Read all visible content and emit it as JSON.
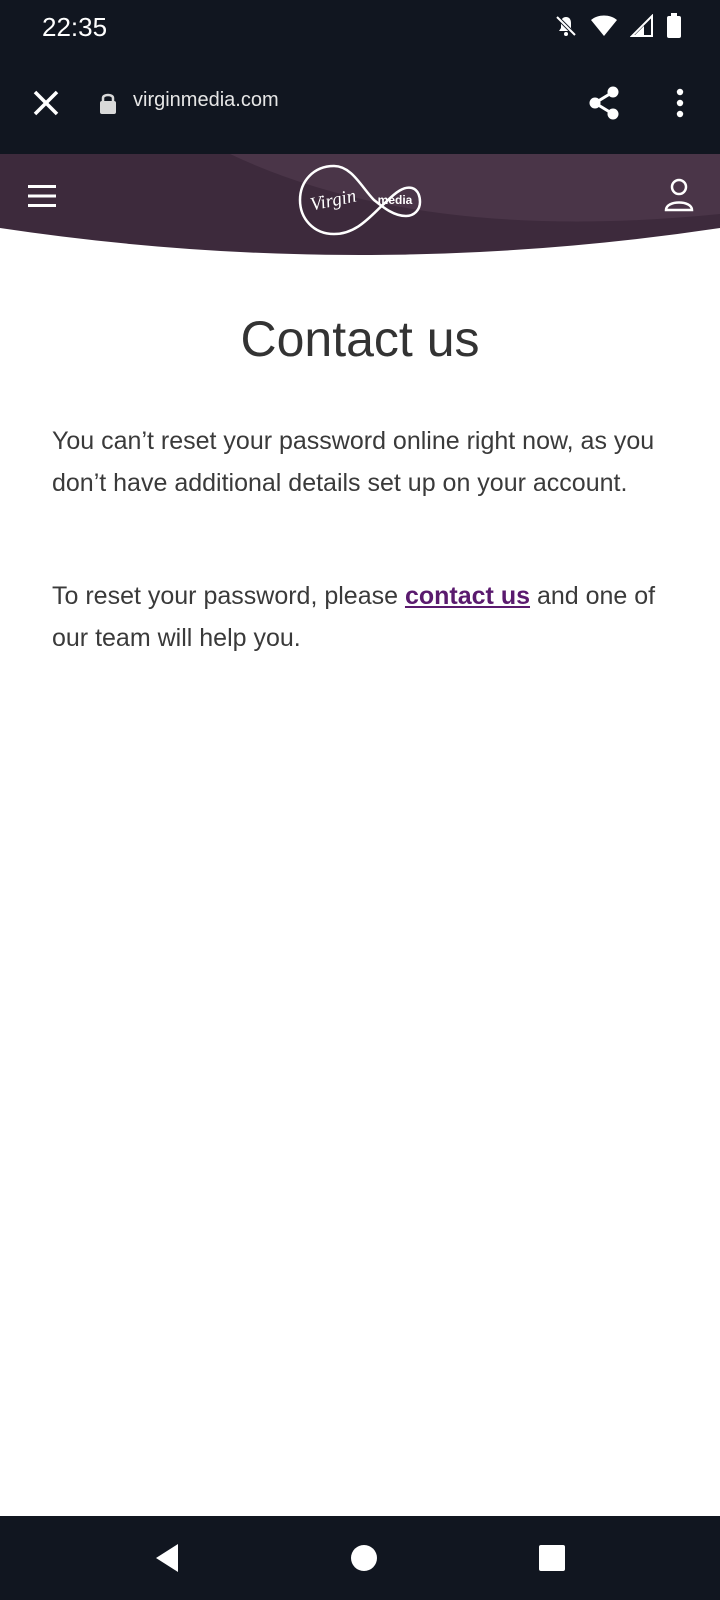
{
  "status_bar": {
    "time": "22:35",
    "icons": [
      "bell-off-icon",
      "wifi-icon",
      "signal-icon",
      "battery-icon"
    ]
  },
  "browser": {
    "url": "virginmedia.com",
    "close_icon": "close-icon",
    "lock_icon": "lock-icon",
    "share_icon": "share-icon",
    "menu_icon": "more-vert-icon"
  },
  "header": {
    "logo_main": "Virgin",
    "logo_sub": "media",
    "menu_icon": "hamburger-icon",
    "account_icon": "account-icon",
    "bg_color": "#3d2a3c"
  },
  "main": {
    "title": "Contact us",
    "paragraph_1": "You can’t reset your password online right now, as you don’t have additional details set up on your account.",
    "paragraph_2_before": "To reset your password, please ",
    "paragraph_2_link": "contact us",
    "paragraph_2_after": " and one of our team will help you.",
    "link_color": "#5a1a6e"
  },
  "nav_bar": {
    "icons": [
      "back-icon",
      "home-icon",
      "recents-icon"
    ]
  }
}
